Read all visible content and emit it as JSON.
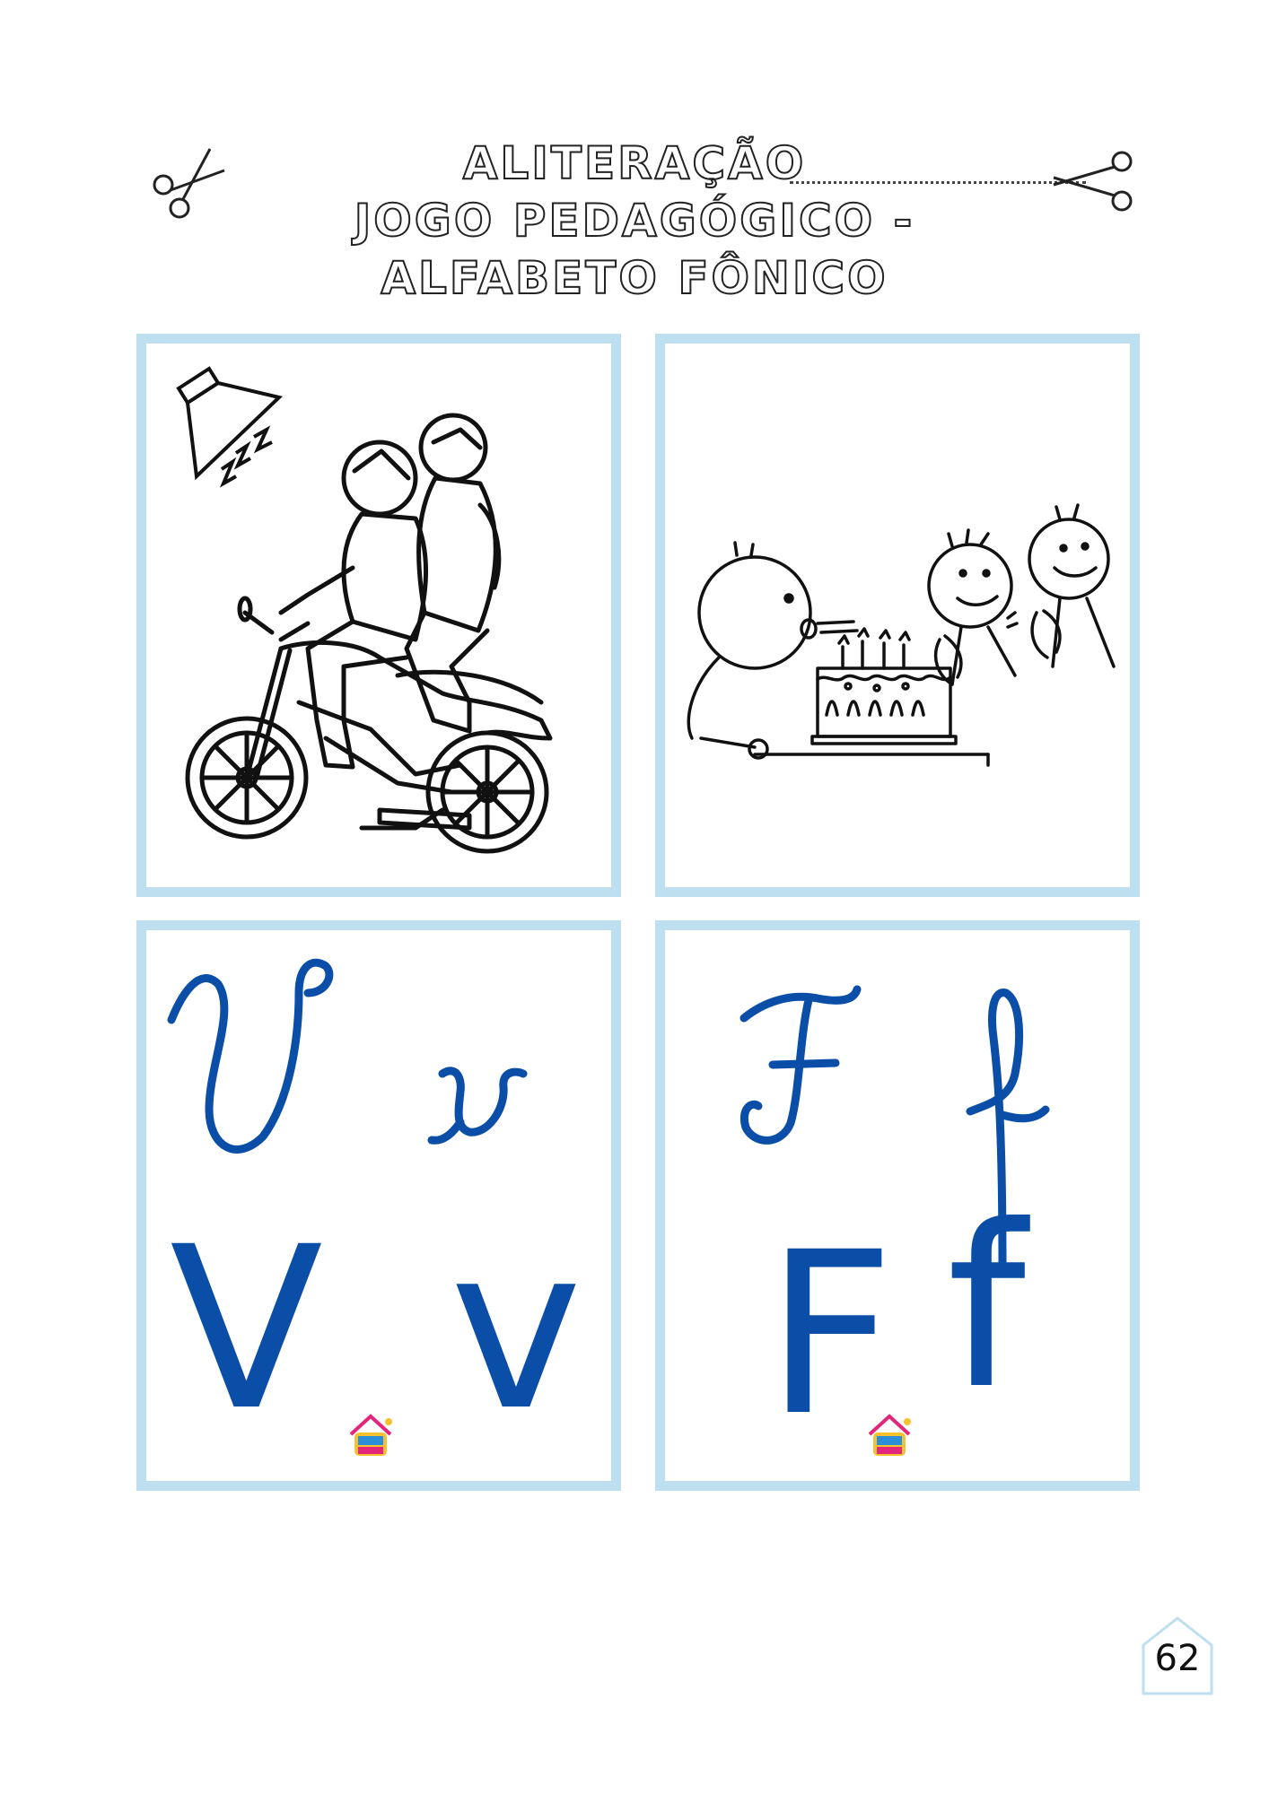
{
  "title": {
    "line1": "ALITERAÇÃO",
    "line2": "JOGO PEDAGÓGICO -",
    "line3": "ALFABETO FÔNICO"
  },
  "cards": [
    {
      "image": "motorcycle-with-two-riders"
    },
    {
      "image": "stick-figures-birthday-cake"
    },
    {
      "cursive_upper": "V",
      "cursive_lower": "v",
      "print_upper": "V",
      "print_lower": "v"
    },
    {
      "cursive_upper": "F",
      "cursive_lower": "f",
      "print_upper": "F",
      "print_lower": "f"
    }
  ],
  "colors": {
    "card_border": "#bddff0",
    "letter": "#0b4ea8"
  },
  "icons": [
    "scissors-icon",
    "headlight-icon",
    "house-icon",
    "casa-logo"
  ],
  "page_number": "62"
}
